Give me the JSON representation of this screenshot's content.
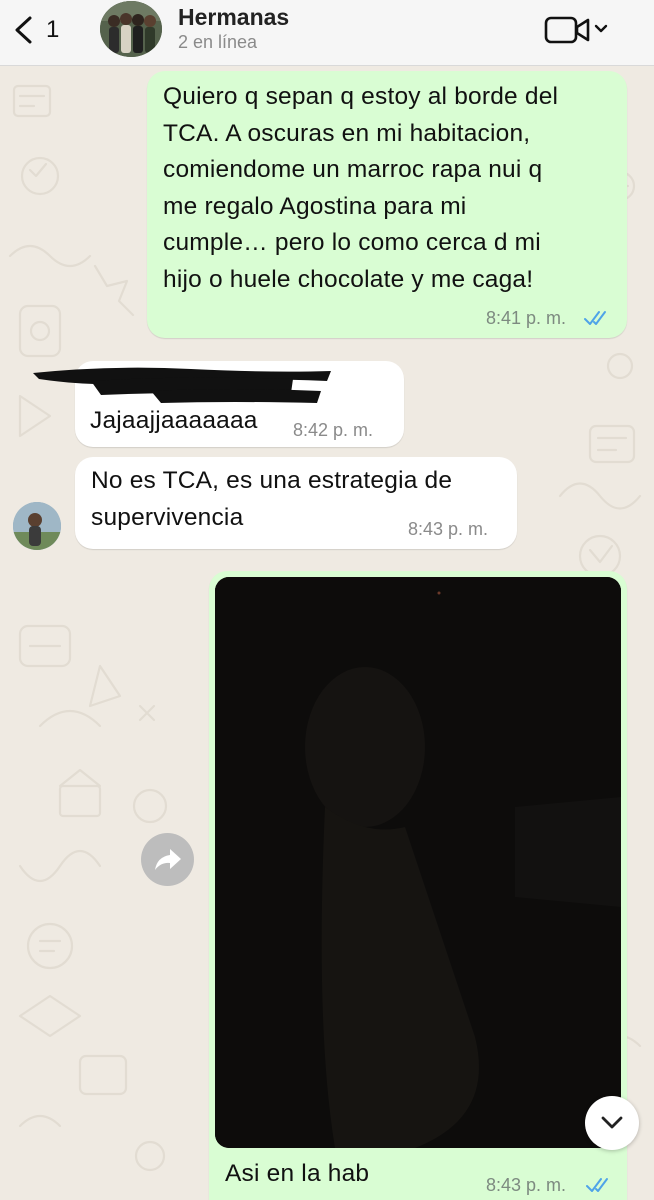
{
  "header": {
    "back_count": "1",
    "group_name": "Hermanas",
    "status": "2 en línea",
    "video_icon": "video-camera-icon"
  },
  "messages": [
    {
      "direction": "outgoing",
      "text": "Quiero q sepan q estoy al borde del TCA. A oscuras en mi habitacion, comiendome un marroc rapa nui q me regalo Agostina para mi cumple… pero lo como cerca d mi hijo o huele chocolate y me caga!",
      "lines": [
        "Quiero q sepan q estoy al borde del",
        "TCA. A oscuras en mi habitacion,",
        "comiendome un marroc rapa nui q",
        "me regalo Agostina para mi",
        "cumple… pero lo como cerca d mi",
        "hijo o huele chocolate y me caga!"
      ],
      "time": "8:41 p. m.",
      "status": "read"
    },
    {
      "direction": "incoming",
      "sender": "[redacted]",
      "text": "Jajaajjaaaaaaa",
      "time": "8:42 p. m."
    },
    {
      "direction": "incoming",
      "text": "No es TCA, es una estrategia de supervivencia",
      "lines": [
        "No es TCA, es una estrategia de",
        "supervivencia"
      ],
      "time": "8:43 p. m."
    },
    {
      "direction": "outgoing",
      "type": "image",
      "caption": "Asi en la hab",
      "time": "8:43 p. m.",
      "status": "read"
    }
  ],
  "controls": {
    "forward_icon": "forward-icon",
    "scroll_down_icon": "chevron-down-icon"
  },
  "colors": {
    "outgoing_bubble": "#d9fdd3",
    "incoming_bubble": "#ffffff",
    "read_ticks": "#4fa3e8",
    "chat_background": "#efeae2"
  }
}
